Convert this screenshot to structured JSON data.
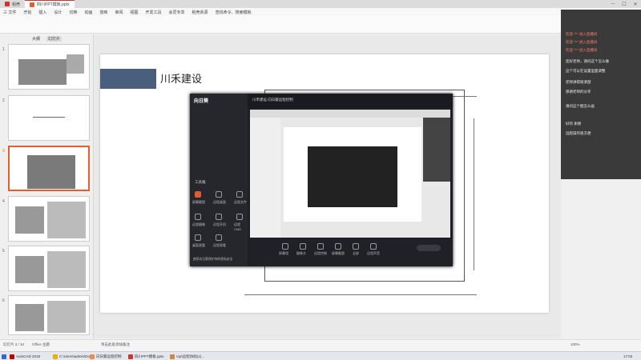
{
  "titlebar": {
    "tabs": [
      {
        "label": "稻壳"
      },
      {
        "label": "四川PPT模板.pptx"
      }
    ],
    "controls": [
      "─",
      "☐",
      "✕"
    ]
  },
  "menubar": {
    "items": [
      "三 文件",
      "开始",
      "插入",
      "设计",
      "切换",
      "动画",
      "放映",
      "审阅",
      "视图",
      "开发工具",
      "会员专享",
      "稻壳资源",
      "查找命令、搜索模板"
    ]
  },
  "sidebar": {
    "tabs": [
      "大纲",
      "幻灯片"
    ],
    "slide_numbers": [
      "1",
      "2",
      "3",
      "4",
      "5",
      "6"
    ]
  },
  "slide": {
    "title": "川禾建设"
  },
  "app": {
    "logo": "向日葵",
    "tab_label": "远程协助",
    "title": "川禾建设 向日葵远程控制",
    "sections": [
      "工具箱"
    ],
    "grid_labels": [
      "屏幕截图",
      "远程桌面",
      "远程文件",
      "远程摄像",
      "远程开机",
      "远程CMD",
      "桌面观看",
      "远程观看"
    ],
    "bottom_tools": [
      "屏幕墙",
      "摄像头",
      "远程控制",
      "屏幕截图",
      "全屏",
      "远程声音"
    ],
    "footer_text": "使用向日葵保护你的隐私安全",
    "footer_badge": "新"
  },
  "right_panel": {
    "lines": [
      {
        "text": "欢迎 *** 进入直播间",
        "red": true
      },
      {
        "text": "欢迎 *** 进入直播间",
        "red": true
      },
      {
        "text": "欢迎 *** 进入直播间",
        "red": true
      },
      {
        "text": "您好老师，请问这个怎么做",
        "red": false
      },
      {
        "text": "这个可以在设置里面调整",
        "red": false
      },
      {
        "text": "老师讲得很清楚",
        "red": false
      },
      {
        "text": "感谢老师的分享",
        "red": false
      },
      {
        "text": "请问这个图怎么画",
        "red": false
      },
      {
        "text": "好的 谢谢",
        "red": false
      },
      {
        "text": "远程操作很方便",
        "red": false
      }
    ]
  },
  "statusbar": {
    "slide_info": "幻灯片 3 / 10",
    "theme": "Office 主题",
    "notes_hint": "单击此处添加备注",
    "zoom": "100%"
  },
  "taskbar": {
    "items": [
      "AutoCAD 2018",
      "C:\\Users\\admin\\Do...",
      "向日葵远程控制",
      "四川PPT模板.pptx",
      "rop\\远程协助(1)..."
    ],
    "time": "17:03"
  },
  "colors": {
    "accent": "#c33333",
    "title_block": "#4a5f7e",
    "app_bg": "#1e1f24",
    "panel_bg": "#3a3a3a"
  }
}
